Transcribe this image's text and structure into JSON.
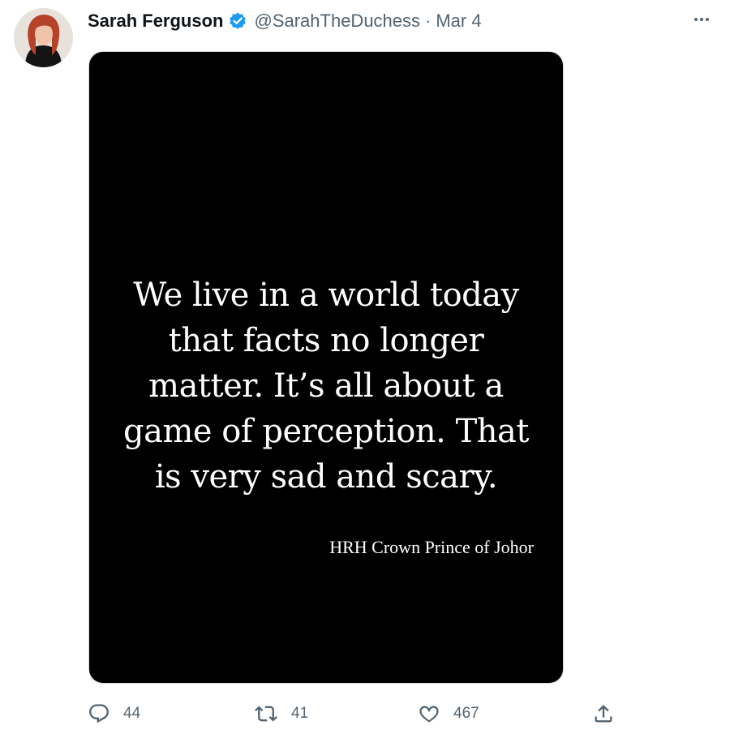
{
  "tweet": {
    "author": {
      "name": "Sarah Ferguson",
      "handle": "@SarahTheDuchess",
      "verified": true,
      "avatar_icon": "profile-photo"
    },
    "separator": "·",
    "date": "Mar 4",
    "more_icon": "more-horizontal-icon",
    "media": {
      "quote_lines": [
        "We live in a world today",
        "that facts no longer",
        "matter. It’s all about a",
        "game of perception. That",
        "is very sad and scary."
      ],
      "attribution": "HRH Crown Prince of Johor",
      "background": "#000000"
    },
    "actions": {
      "reply": {
        "icon": "reply-icon",
        "count": "44"
      },
      "retweet": {
        "icon": "retweet-icon",
        "count": "41"
      },
      "like": {
        "icon": "heart-icon",
        "count": "467"
      },
      "share": {
        "icon": "share-icon"
      }
    }
  },
  "colors": {
    "text_primary": "#0f1419",
    "text_secondary": "#536471",
    "verified_blue": "#1d9bf0",
    "border": "#cfd9de"
  }
}
